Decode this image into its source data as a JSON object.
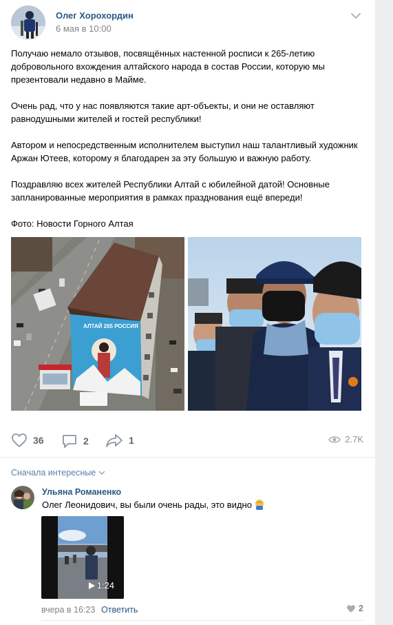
{
  "post": {
    "author": "Олег Хорохордин",
    "date": "6 мая в 10:00",
    "paragraphs": [
      "Получаю немало отзывов, посвящённых настенной росписи к 265-летию добровольного вхождения алтайского народа в состав России, которую мы презентовали недавно в Майме.",
      "Очень рад, что у нас появляются такие арт-объекты, и они не оставляют равнодушными жителей и гостей республики!",
      "Автором и непосредственным исполнителем выступил наш талантливый художник Аржан Ютеев, которому я благодарен за эту большую и важную работу.",
      "Поздравляю всех жителей Республики Алтай с юбилейной датой! Основные запланированные мероприятия в рамках празднования ещё впереди!",
      "Фото: Новости Горного Алтая"
    ],
    "mural_text": "АЛТАЙ 265 РОССИЯ"
  },
  "actions": {
    "likes": "36",
    "comments": "2",
    "shares": "1",
    "views": "2.7K"
  },
  "comments": {
    "sort_label": "Сначала интересные",
    "items": [
      {
        "author": "Ульяна Романенко",
        "text": "Олег Леонидович, вы были очень рады, это видно",
        "video_duration": "1:24",
        "date": "вчера в 16:23",
        "reply_label": "Ответить",
        "likes": "2"
      }
    ]
  },
  "colors": {
    "link": "#2a5885",
    "muted": "#828282",
    "background": "#edeef0"
  },
  "icons": [
    "chevron-down-icon",
    "heart-icon",
    "comment-icon",
    "share-icon",
    "eye-icon",
    "play-icon"
  ]
}
